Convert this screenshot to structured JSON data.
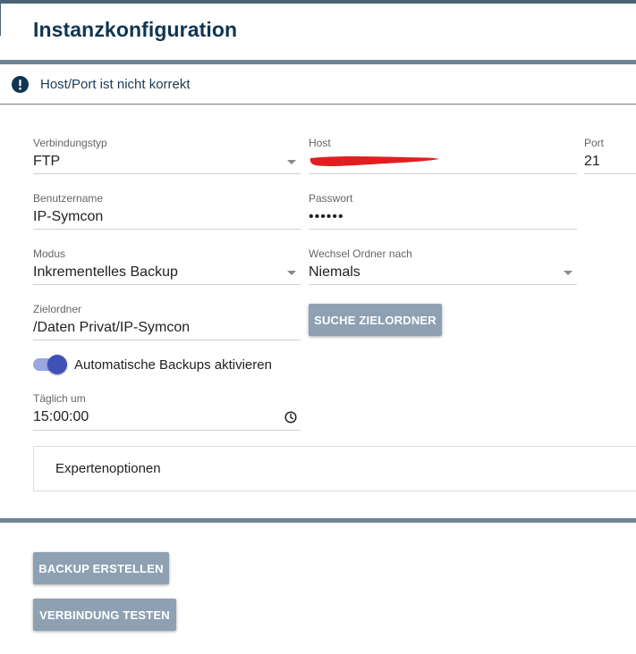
{
  "header": {
    "title": "Instanzkonfiguration"
  },
  "alert": {
    "icon": "exclamation-icon",
    "text": "Host/Port ist nicht korrekt"
  },
  "form": {
    "verbindungstyp": {
      "label": "Verbindungstyp",
      "value": "FTP"
    },
    "host": {
      "label": "Host",
      "value": ""
    },
    "port": {
      "label": "Port",
      "value": "21"
    },
    "benutzername": {
      "label": "Benutzername",
      "value": "IP-Symcon"
    },
    "passwort": {
      "label": "Passwort",
      "value": "••••••"
    },
    "modus": {
      "label": "Modus",
      "value": "Inkrementelles Backup"
    },
    "wechsel": {
      "label": "Wechsel Ordner nach",
      "value": "Niemals"
    },
    "zielordner": {
      "label": "Zielordner",
      "value": "/Daten Privat/IP-Symcon"
    },
    "suche_button": "SUCHE ZIELORDNER",
    "auto_backup": {
      "label": "Automatische Backups aktivieren",
      "enabled": true
    },
    "taeglich": {
      "label": "Täglich um",
      "value": "15:00:00"
    },
    "expert": "Expertenoptionen"
  },
  "actions": {
    "backup_erstellen": "BACKUP ERSTELLEN",
    "verbindung_testen": "VERBINDUNG TESTEN"
  },
  "colors": {
    "title": "#0f3553",
    "button": "#8ea1b3",
    "toggle_knob": "#3f51b5",
    "redaction": "#e02020"
  }
}
